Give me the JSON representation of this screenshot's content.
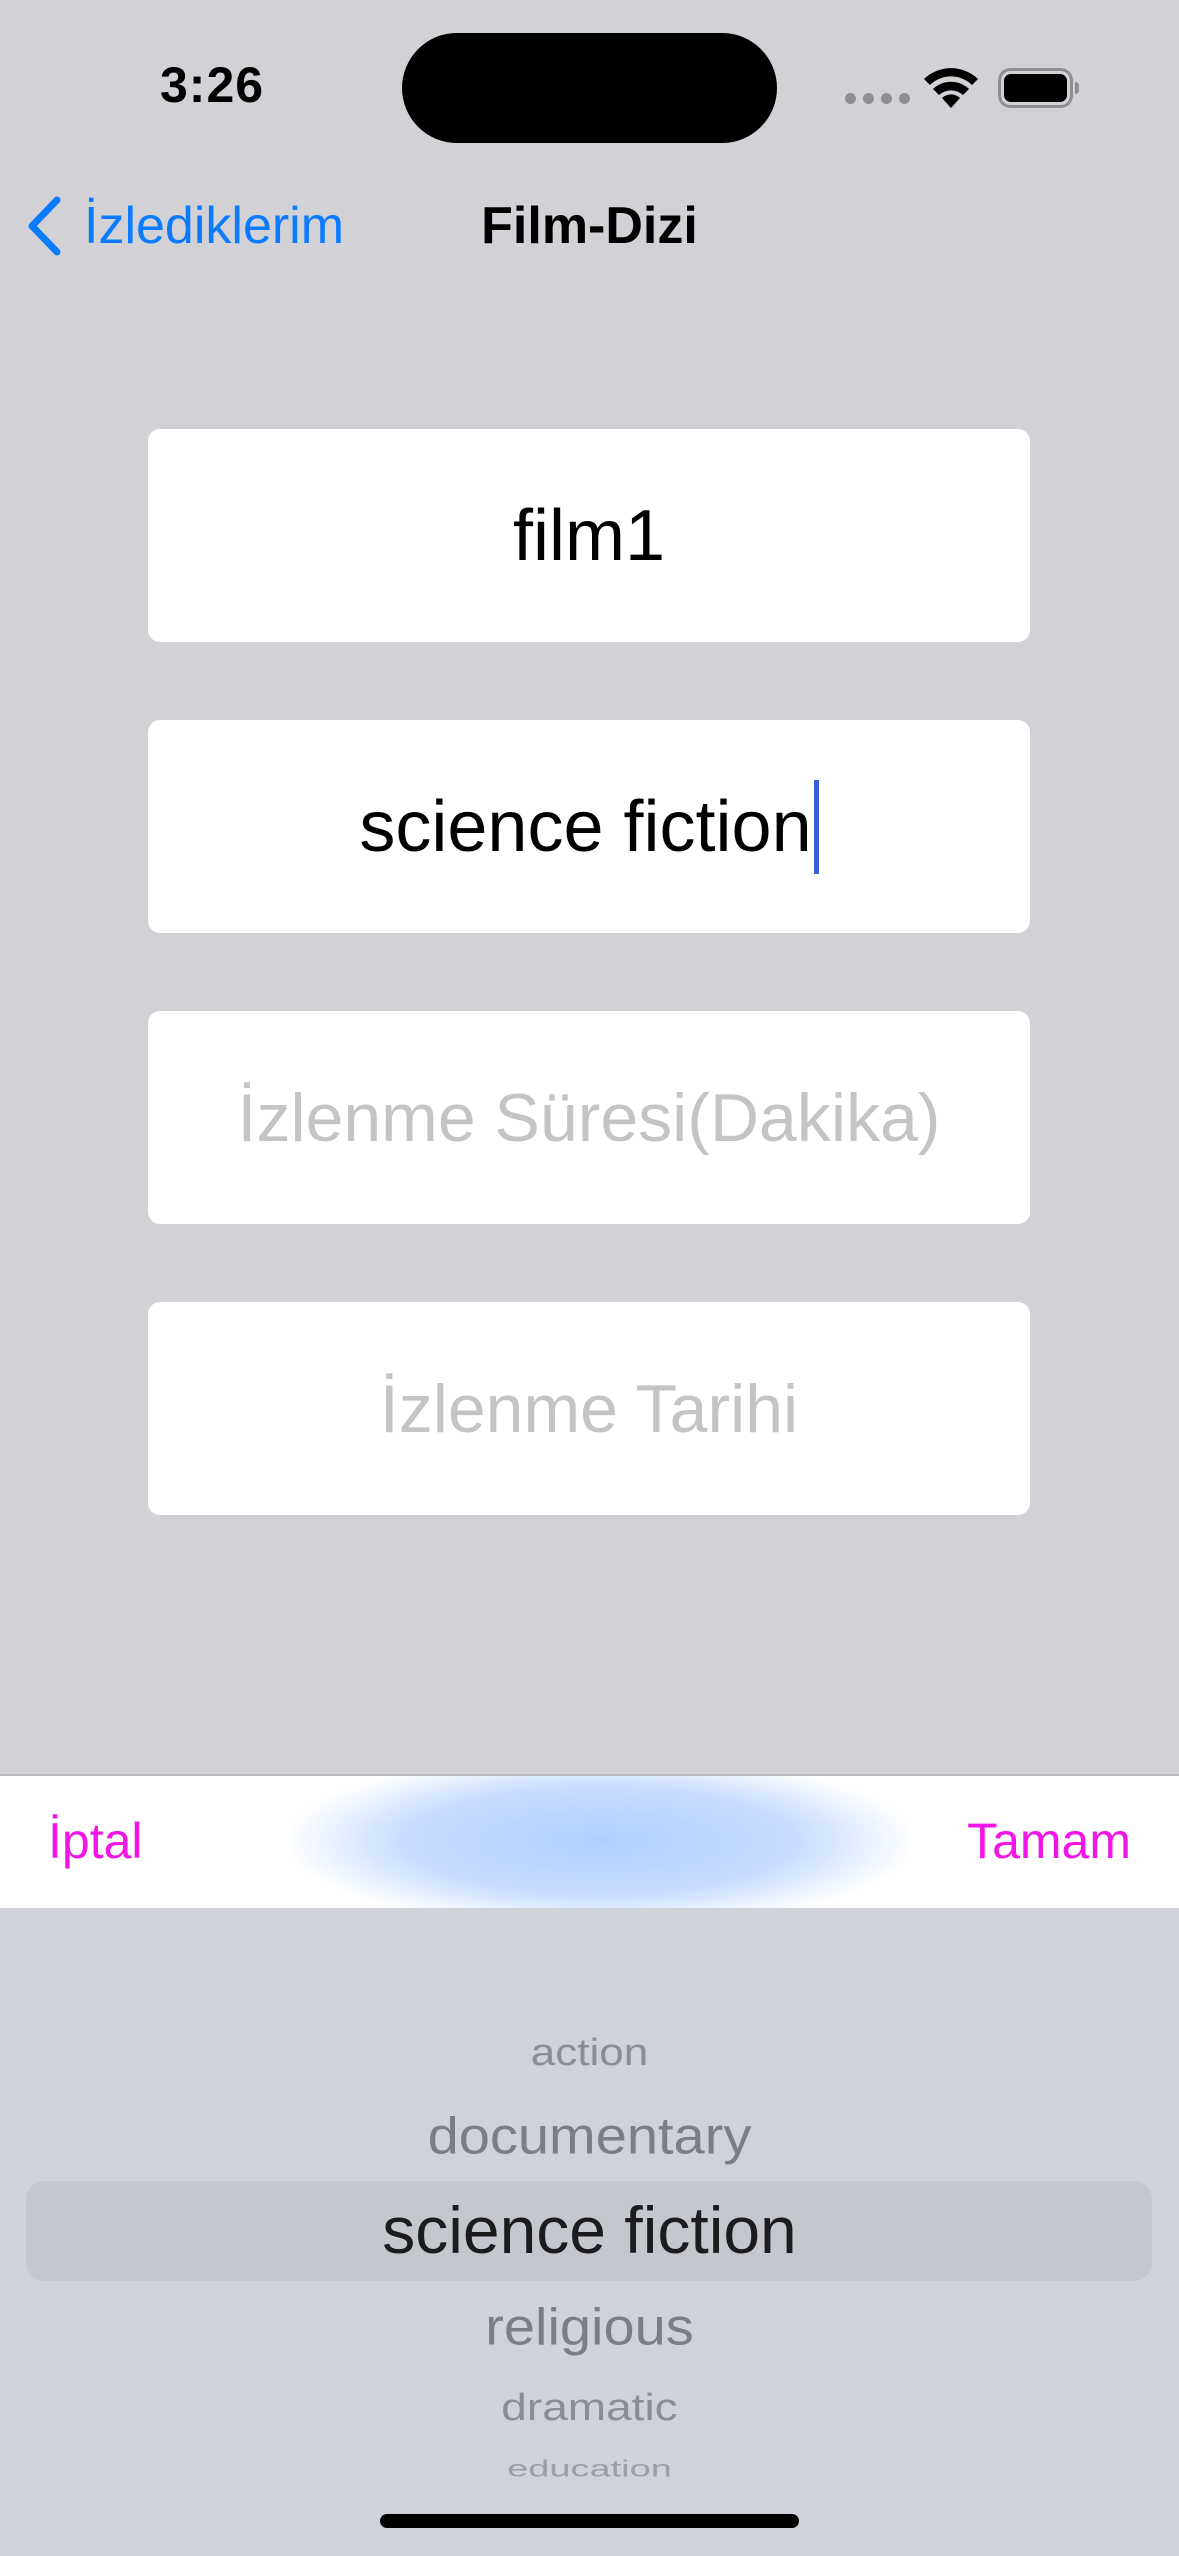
{
  "status_bar": {
    "time": "3:26",
    "icons": [
      "cellular-signal-icon",
      "wifi-icon",
      "battery-icon"
    ]
  },
  "nav": {
    "back_label": "İzlediklerim",
    "title": "Film-Dizi"
  },
  "form": {
    "name_value": "film1",
    "genre_value": "science fiction",
    "duration_placeholder": "İzlenme Süresi(Dakika)",
    "date_placeholder": "İzlenme Tarihi"
  },
  "toolbar": {
    "cancel_label": "İptal",
    "done_label": "Tamam"
  },
  "picker": {
    "options": [
      "action",
      "documentary",
      "science fiction",
      "religious",
      "dramatic",
      "education"
    ],
    "selected": "science fiction"
  },
  "colors": {
    "accent_blue": "#0a7aff",
    "toolbar_magenta": "#f215e6",
    "background": "#d1d1d6"
  }
}
